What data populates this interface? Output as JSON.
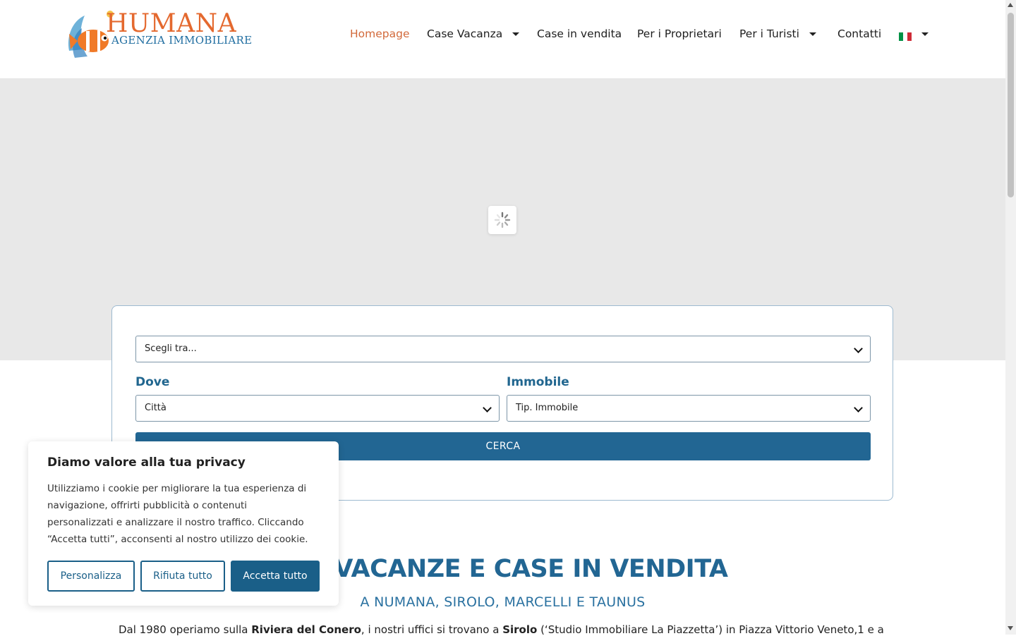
{
  "brand": {
    "name": "HUMANA",
    "tagline": "AGENZIA IMMOBILIARE",
    "primary_color": "#226693",
    "accent_color": "#e4692f"
  },
  "nav": {
    "items": [
      {
        "label": "Homepage",
        "active": true,
        "has_dropdown": false
      },
      {
        "label": "Case Vacanza",
        "active": false,
        "has_dropdown": true
      },
      {
        "label": "Case in vendita",
        "active": false,
        "has_dropdown": false
      },
      {
        "label": "Per i Proprietari",
        "active": false,
        "has_dropdown": false
      },
      {
        "label": "Per i Turisti",
        "active": false,
        "has_dropdown": true
      },
      {
        "label": "Contatti",
        "active": false,
        "has_dropdown": false
      }
    ],
    "language_icon": "italy-flag-icon"
  },
  "hero": {
    "loading_icon": "spinner-icon"
  },
  "search": {
    "type_select": "Scegli tra...",
    "where_label": "Dove",
    "where_select": "Città",
    "property_label": "Immobile",
    "property_select": "Tip. Immobile",
    "button_label": "CERCA"
  },
  "content": {
    "title_visible": "SE VACANZE E CASE IN VENDITA",
    "subtitle": "A NUMANA, SIROLO, MARCELLI E TAUNUS",
    "intro_parts": [
      "Dal 1980 operiamo sulla ",
      "Riviera del Conero",
      ", i nostri uffici si trovano a ",
      "Sirolo",
      " (‘Studio Immobiliare La Piazzetta’) in Piazza Vittorio Veneto,1 e a"
    ]
  },
  "cookie": {
    "title": "Diamo valore alla tua privacy",
    "text": "Utilizziamo i cookie per migliorare la tua esperienza di navigazione, offrirti pubblicità o contenuti personalizzati e analizzare il nostro traffico. Cliccando “Accetta tutti”, acconsenti al nostro utilizzo dei cookie.",
    "customize_label": "Personalizza",
    "reject_label": "Rifiuta tutto",
    "accept_label": "Accetta tutto"
  }
}
